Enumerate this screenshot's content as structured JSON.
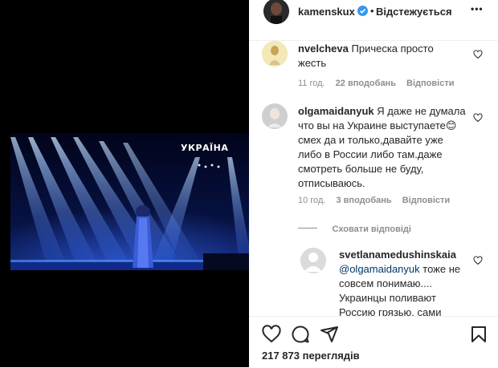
{
  "post": {
    "overlay_text": "УКРАЇНА"
  },
  "header": {
    "username": "kamenskux",
    "separator": "•",
    "follow_label": "Відстежується",
    "more_glyph": "•••"
  },
  "comments": [
    {
      "username": "nvelcheva",
      "text_line1": "Прическа просто",
      "text_line2": "жесть",
      "time": "11 год.",
      "likes": "22 вподобань",
      "reply": "Відповісти"
    },
    {
      "username": "olgamaidanyuk",
      "text_line1": "Я даже не думала",
      "text_line2": "что вы на Украине выступаете😊",
      "text_line3": "смех да и только,давайте уже",
      "text_line4": "либо в России либо там.даже",
      "text_line5": "смотреть больше не буду,",
      "text_line6": "отписываюсь.",
      "time": "10 год.",
      "likes": "3 вподобань",
      "reply": "Відповісти",
      "hide_replies": "Сховати відповіді"
    },
    {
      "username": "svetlanamedushinskaia",
      "mention": "@olgamaidanyuk",
      "text_line1_rest": " тоже не",
      "text_line2": "совсем понимаю....",
      "text_line3": "Украинцы поливают",
      "text_line4": "Россию грязью, сами"
    }
  ],
  "actions": {
    "views": "217 873 переглядів"
  },
  "colors": {
    "link_blue": "#0095f6",
    "verified_blue": "#3897f0",
    "muted": "#8e8e8e",
    "text": "#262626"
  }
}
